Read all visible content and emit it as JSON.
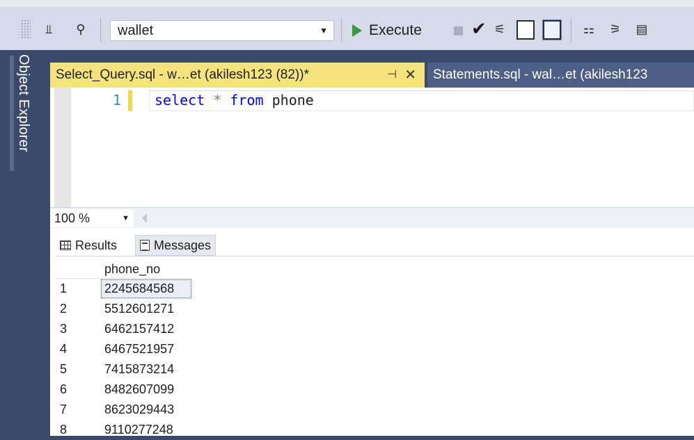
{
  "toolbar": {
    "database": "wallet",
    "execute_label": "Execute",
    "icons": [
      "grip-icon",
      "connect-icon",
      "filter-icon",
      "database-dropdown",
      "execute-icon",
      "stop-icon",
      "parse-check-icon",
      "plan-icon",
      "results-text-icon",
      "results-grid-icon",
      "compare-icon",
      "client-stats-icon",
      "query-options-icon"
    ]
  },
  "sidebar": {
    "label": "Object Explorer"
  },
  "tabs": [
    {
      "label": "Select_Query.sql - w…et (akilesh123 (82))*",
      "active": true
    },
    {
      "label": "Statements.sql - wal…et (akilesh123",
      "active": false
    }
  ],
  "tab_icons": {
    "pin": "⊣",
    "close": "✕"
  },
  "editor": {
    "line_number": "1",
    "tokens": {
      "select": "select",
      "star": "*",
      "from": "from",
      "table": "phone"
    }
  },
  "zoom": {
    "value": "100 %"
  },
  "results": {
    "tabs": [
      {
        "label": "Results",
        "active": true
      },
      {
        "label": "Messages",
        "active": false
      }
    ],
    "column_header": "phone_no",
    "rows": [
      {
        "n": "1",
        "v": "2245684568"
      },
      {
        "n": "2",
        "v": "5512601271"
      },
      {
        "n": "3",
        "v": "6462157412"
      },
      {
        "n": "4",
        "v": "6467521957"
      },
      {
        "n": "5",
        "v": "7415873214"
      },
      {
        "n": "6",
        "v": "8482607099"
      },
      {
        "n": "7",
        "v": "8623029443"
      },
      {
        "n": "8",
        "v": "9110277248"
      }
    ]
  },
  "colors": {
    "active_tab": "#f5e47b",
    "inactive_tab": "#4d5f87",
    "ide_background": "#3b4a6b",
    "keyword": "#0000ff",
    "line_number": "#2b91af"
  }
}
